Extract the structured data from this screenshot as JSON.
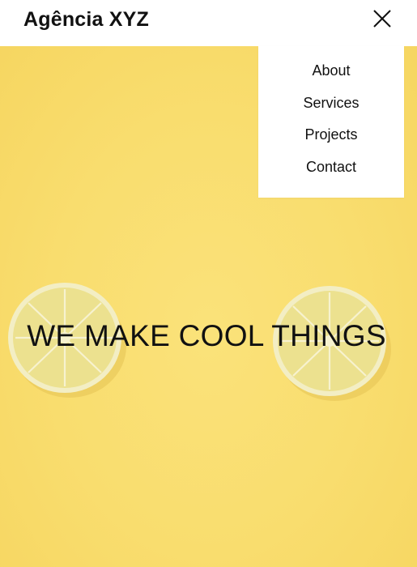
{
  "header": {
    "brand": "Agência XYZ",
    "close_icon": "close-x-icon"
  },
  "menu": {
    "items": [
      {
        "label": "About"
      },
      {
        "label": "Services"
      },
      {
        "label": "Projects"
      },
      {
        "label": "Contact"
      }
    ]
  },
  "hero": {
    "headline": "WE MAKE COOL THINGS",
    "background_color": "#f9dd6e",
    "image_subject": "lemon-slices-icon"
  },
  "colors": {
    "header_bg": "#ffffff",
    "text": "#111111",
    "hero_bg": "#f9dd6e"
  }
}
